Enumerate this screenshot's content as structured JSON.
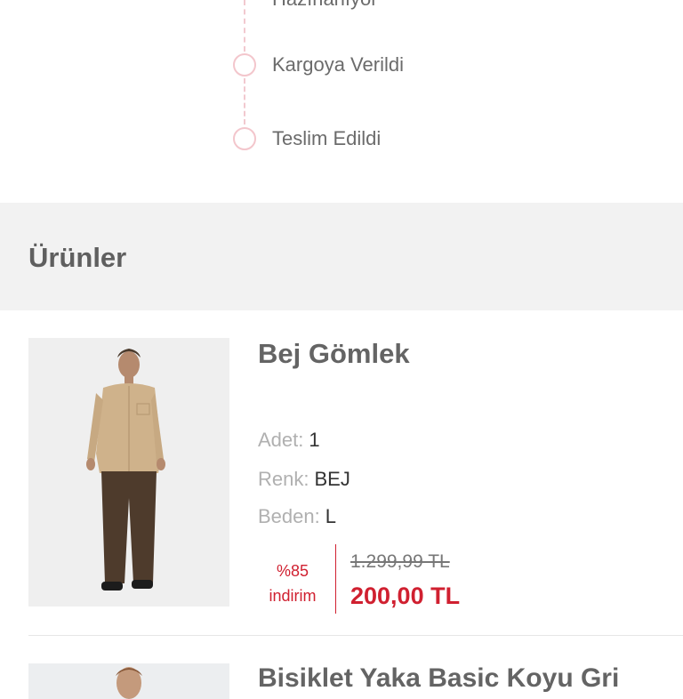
{
  "timeline": {
    "steps": [
      {
        "label": "Hazırlanıyor"
      },
      {
        "label": "Kargoya Verildi"
      },
      {
        "label": "Teslim Edildi"
      }
    ]
  },
  "section": {
    "title": "Ürünler"
  },
  "products": [
    {
      "title": "Bej Gömlek",
      "attributes": [
        {
          "key": "Adet:",
          "value": "1"
        },
        {
          "key": "Renk:",
          "value": "BEJ"
        },
        {
          "key": "Beden:",
          "value": "L"
        }
      ],
      "discount_line1": "%85",
      "discount_line2": "indirim",
      "old_price": "1.299,99 TL",
      "new_price": "200,00 TL"
    },
    {
      "title": "Bisiklet Yaka Basic Koyu Gri"
    }
  ],
  "colors": {
    "accent": "#d02030",
    "timeline_circle": "#f3c6cc",
    "section_bg": "#f2f2f2"
  }
}
